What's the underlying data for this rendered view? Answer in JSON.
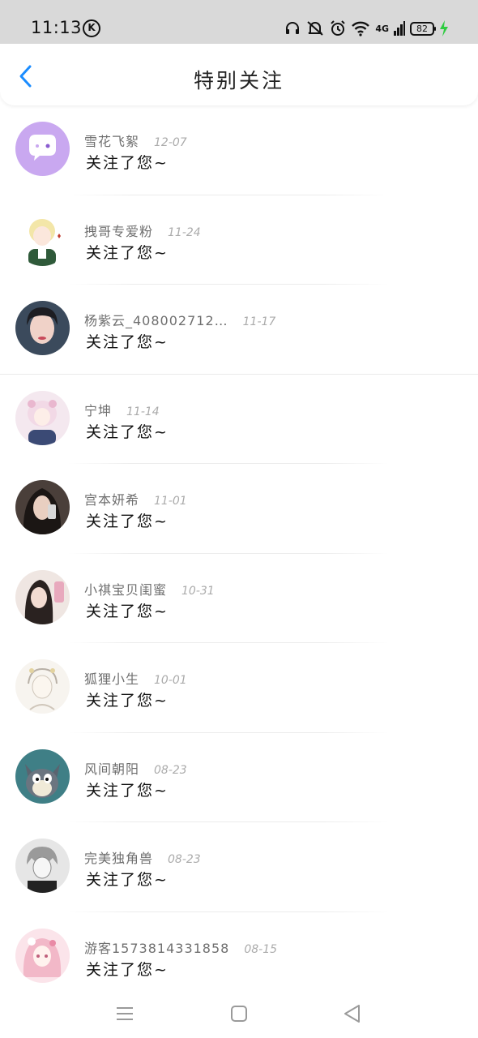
{
  "status_bar": {
    "time": "11:13",
    "k_badge": "K",
    "network": "4G",
    "battery": "82",
    "icons": [
      "headphones-icon",
      "mute-icon",
      "alarm-icon",
      "wifi-icon",
      "signal-icon",
      "battery-icon",
      "charging-icon"
    ],
    "charging_color": "#2ecc40"
  },
  "header": {
    "title": "特别关注",
    "back_icon": "chevron-left-icon",
    "accent_color": "#1a8cff"
  },
  "list": [
    {
      "name": "雪花飞絮",
      "date": "12-07",
      "message": "关注了您~",
      "avatar": "purple-chat-avatar"
    },
    {
      "name": "拽哥专爱粉",
      "date": "11-24",
      "message": "关注了您~",
      "avatar": "anime-boy-avatar"
    },
    {
      "name": "杨紫云_408002712…",
      "date": "11-17",
      "message": "关注了您~",
      "avatar": "photo-avatar"
    },
    {
      "name": "宁坤",
      "date": "11-14",
      "message": "关注了您~",
      "avatar": "anime-girl-avatar"
    },
    {
      "name": "宫本妍希",
      "date": "11-01",
      "message": "关注了您~",
      "avatar": "photo-avatar"
    },
    {
      "name": "小祺宝贝闺蜜",
      "date": "10-31",
      "message": "关注了您~",
      "avatar": "photo-avatar"
    },
    {
      "name": "狐狸小生",
      "date": "10-01",
      "message": "关注了您~",
      "avatar": "sketch-avatar"
    },
    {
      "name": "风间朝阳",
      "date": "08-23",
      "message": "关注了您~",
      "avatar": "cartoon-cat-avatar"
    },
    {
      "name": "完美独角兽",
      "date": "08-23",
      "message": "关注了您~",
      "avatar": "manga-avatar"
    },
    {
      "name": "游客1573814331858",
      "date": "08-15",
      "message": "关注了您~",
      "avatar": "pink-anime-avatar"
    }
  ],
  "nav_bar": {
    "menu_icon": "menu-icon",
    "home_icon": "home-square-icon",
    "back_icon": "back-triangle-icon"
  }
}
